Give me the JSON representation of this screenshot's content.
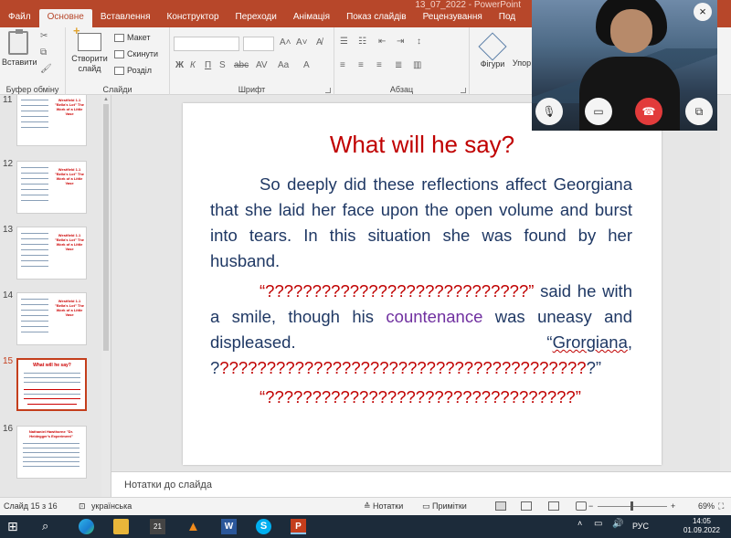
{
  "window": {
    "title": "13_07_2022 - PowerPoint"
  },
  "tabs": [
    {
      "label": "Файл"
    },
    {
      "label": "Основне"
    },
    {
      "label": "Вставлення"
    },
    {
      "label": "Конструктор"
    },
    {
      "label": "Переходи"
    },
    {
      "label": "Анімація"
    },
    {
      "label": "Показ слайдів"
    },
    {
      "label": "Рецензування"
    },
    {
      "label": "Под"
    }
  ],
  "ribbon": {
    "clipboard": {
      "paste": "Вставити",
      "group": "Буфер обміну"
    },
    "slides": {
      "new_slide_1": "Створити",
      "new_slide_2": "слайд",
      "layout": "Макет",
      "reset": "Скинути",
      "section": "Розділ",
      "group": "Слайди"
    },
    "font": {
      "group": "Шрифт"
    },
    "paragraph": {
      "group": "Абзац"
    },
    "drawing": {
      "shapes": "Фігури",
      "arrange": "Упор"
    }
  },
  "thumbnails": [
    {
      "num": "11",
      "title": "Westfield 1.1 \"Bella's Lot\" The Work of a Little Vase"
    },
    {
      "num": "12",
      "title": "Westfield 1.1 \"Bella's Lot\" The Work of a Little Vase"
    },
    {
      "num": "13",
      "title": "Westfield 1.1 \"Bella's Lot\" The Work of a Little Vase"
    },
    {
      "num": "14",
      "title": "Westfield 1.1 \"Bella's Lot\" The Work of a Little Vase"
    },
    {
      "num": "15",
      "title": "What will he say?"
    },
    {
      "num": "16",
      "title": "Nathaniel Hawthorne \"Dr. Heidegger's Experiment\""
    }
  ],
  "slide": {
    "title": "What will he say?",
    "p1": "So deeply did these reflections affect Georgiana that she laid her face upon the open volume and burst into tears. In this situation she was found by her husband.",
    "p2_q": "“????????????????????????????”",
    "p2_a": " said he with a smile, though his ",
    "p2_word": "countenance",
    "p2_b": " was uneasy and displeased. “",
    "p2_name": "Grorgiana",
    "p2_c": ", ?",
    "p2_q2": "???????????????????????????????????????",
    "p2_d": "?”",
    "p3": "“?????????????????????????????????”"
  },
  "notes": {
    "placeholder": "Нотатки до слайда"
  },
  "status": {
    "slide_of": "Слайд 15 з 16",
    "language": "українська",
    "notes_btn": "Нотатки",
    "comments_btn": "Примітки",
    "zoom": "69%"
  },
  "taskbar": {
    "lang": "РУС",
    "time": "14:05",
    "date": "01.09.2022"
  },
  "colors": {
    "accent": "#b7472a",
    "slide_title": "#c00000",
    "body_text": "#1f3864",
    "end_call": "#e23b3b"
  }
}
